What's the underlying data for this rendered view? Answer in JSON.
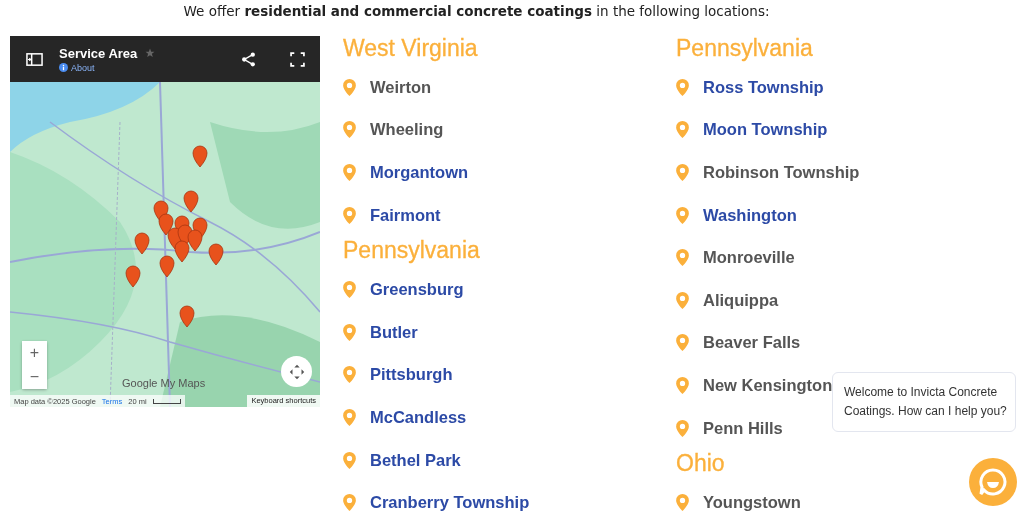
{
  "intro": "We offer **residential and commercial concrete coatings** in the following locations:",
  "map": {
    "title": "Service Area",
    "about": "About",
    "zoom_in": "+",
    "zoom_out": "−",
    "logo": "Google My Maps",
    "attribution": "Map data ©2025 Google",
    "terms": "Terms",
    "scale": "20 mi",
    "shortcuts": "Keyboard shortcuts"
  },
  "columns": [
    [
      {
        "state": "West Virginia",
        "cities": [
          {
            "name": "Weirton",
            "linked": false
          },
          {
            "name": "Wheeling",
            "linked": false
          },
          {
            "name": "Morgantown",
            "linked": true
          },
          {
            "name": "Fairmont",
            "linked": true
          }
        ]
      },
      {
        "state": "Pennsylvania",
        "cities": [
          {
            "name": "Greensburg",
            "linked": true
          },
          {
            "name": "Butler",
            "linked": true
          },
          {
            "name": "Pittsburgh",
            "linked": true
          },
          {
            "name": "McCandless",
            "linked": true
          },
          {
            "name": "Bethel Park",
            "linked": true
          },
          {
            "name": "Cranberry Township",
            "linked": true
          }
        ]
      }
    ],
    [
      {
        "state": "Pennsylvania",
        "cities": [
          {
            "name": "Ross Township",
            "linked": true
          },
          {
            "name": "Moon Township",
            "linked": true
          },
          {
            "name": "Robinson Township",
            "linked": false
          },
          {
            "name": "Washington",
            "linked": true
          },
          {
            "name": "Monroeville",
            "linked": false
          },
          {
            "name": "Aliquippa",
            "linked": false
          },
          {
            "name": "Beaver Falls",
            "linked": false
          },
          {
            "name": "New Kensington",
            "linked": false
          },
          {
            "name": "Penn Hills",
            "linked": false
          }
        ]
      },
      {
        "state": "Ohio",
        "cities": [
          {
            "name": "Youngstown",
            "linked": false
          }
        ]
      }
    ]
  ],
  "chat": {
    "message": "Welcome to Invicta Concrete Coatings. How can I help you?"
  }
}
